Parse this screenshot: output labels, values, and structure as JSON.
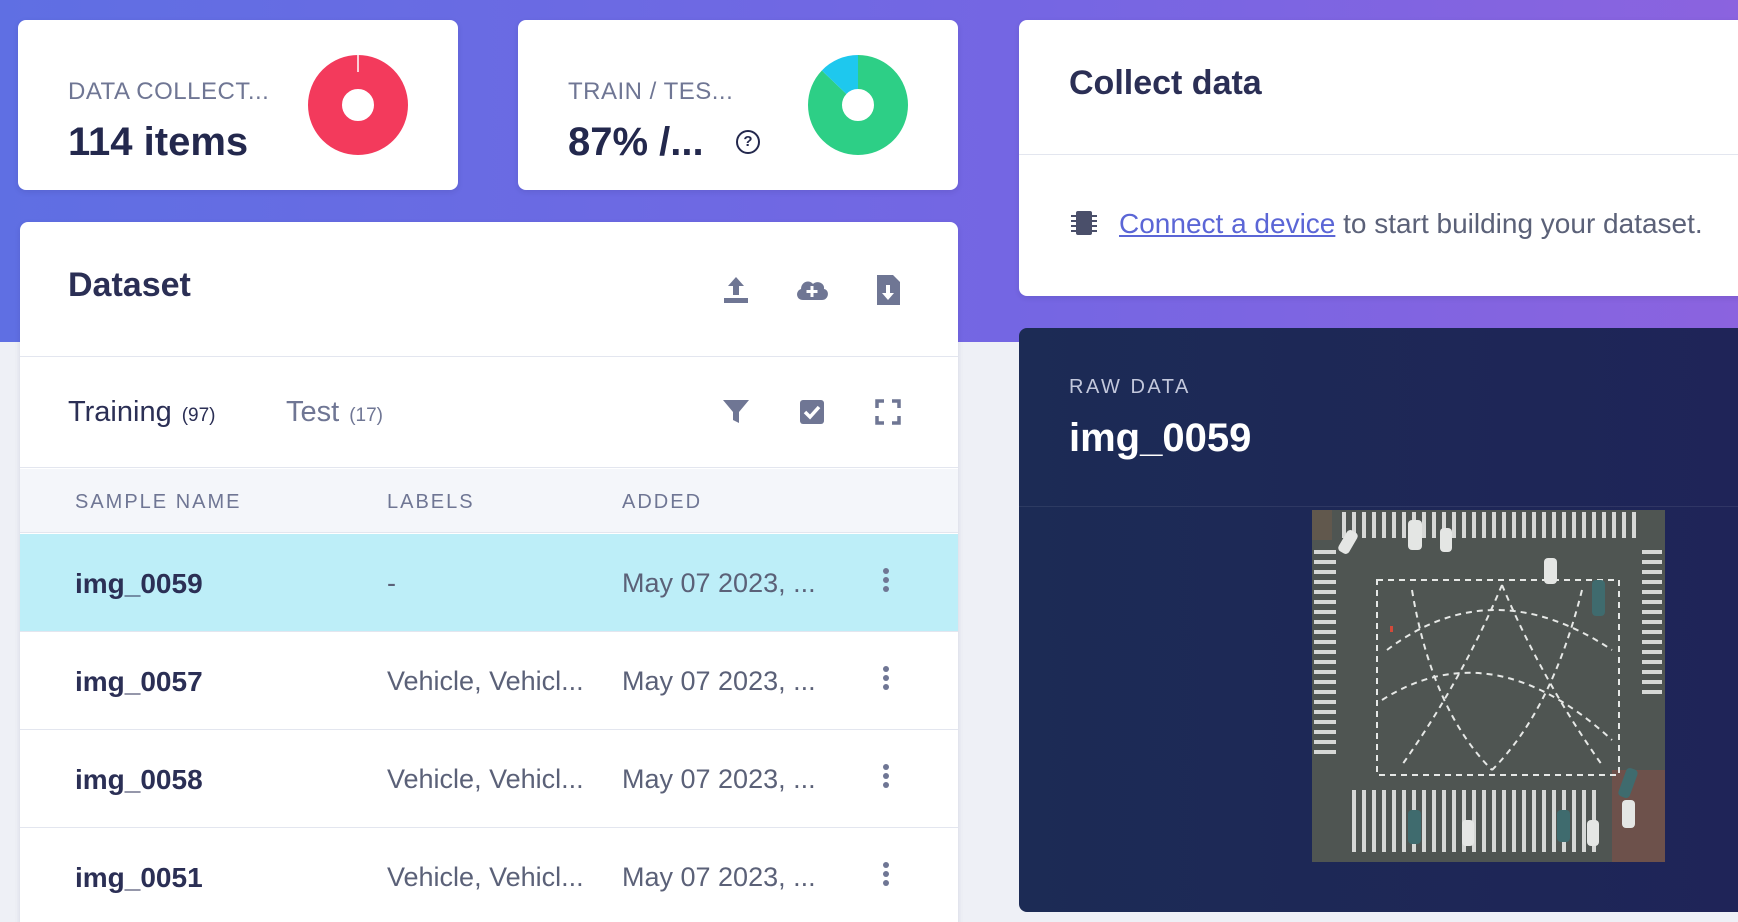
{
  "colors": {
    "banner": "#6b6ae3",
    "donut_collected": "#f33a5c",
    "donut_train": "#2dcf86",
    "donut_test": "#1ec8ee",
    "selected_row": "#bdeef8",
    "link": "#5b66d6",
    "raw_panel": "#1d2756"
  },
  "stats": {
    "collected": {
      "label": "DATA COLLECT...",
      "value": "114 items",
      "fraction": 1.0
    },
    "split": {
      "label": "TRAIN / TES...",
      "value": "87% /...",
      "train_fraction": 0.87,
      "help_icon": "question-circle-icon",
      "help_glyph": "?"
    }
  },
  "dataset": {
    "title": "Dataset",
    "actions": [
      "upload-icon",
      "cloud-add-icon",
      "download-icon"
    ],
    "tabs": [
      {
        "label": "Training",
        "count": "(97)",
        "active": true
      },
      {
        "label": "Test",
        "count": "(17)",
        "active": false
      }
    ],
    "tools": [
      "filter-icon",
      "checkbox-select-icon",
      "expand-icon"
    ],
    "columns": [
      "SAMPLE NAME",
      "LABELS",
      "ADDED"
    ],
    "rows": [
      {
        "name": "img_0059",
        "labels": "-",
        "added": "May 07 2023, ...",
        "selected": true
      },
      {
        "name": "img_0057",
        "labels": "Vehicle, Vehicl...",
        "added": "May 07 2023, ...",
        "selected": false
      },
      {
        "name": "img_0058",
        "labels": "Vehicle, Vehicl...",
        "added": "May 07 2023, ...",
        "selected": false
      },
      {
        "name": "img_0051",
        "labels": "Vehicle, Vehicl...",
        "added": "May 07 2023, ...",
        "selected": false
      }
    ]
  },
  "collect": {
    "title": "Collect data",
    "icon": "chip-icon",
    "link_text": "Connect a device",
    "rest_text": " to start building your dataset."
  },
  "raw": {
    "label": "RAW DATA",
    "title": "img_0059",
    "image": "aerial-intersection-image"
  }
}
